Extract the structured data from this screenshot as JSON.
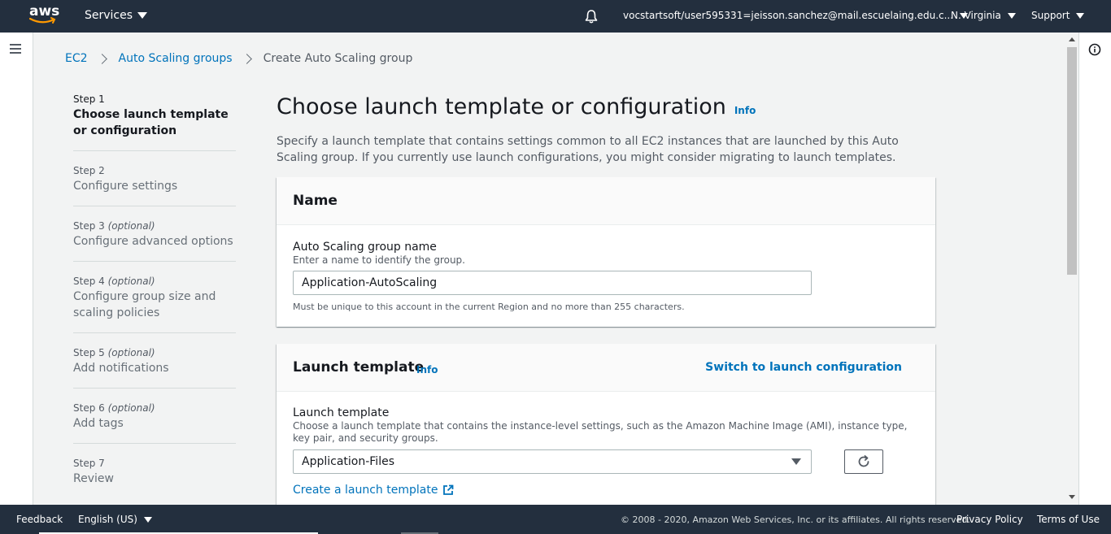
{
  "topnav": {
    "logo_text": "aws",
    "services_label": "Services",
    "account_label": "vocstartsoft/user595331=jeisson.sanchez@mail.escuelaing.edu.c...",
    "region_label": "N. Virginia",
    "support_label": "Support"
  },
  "breadcrumb": {
    "items": [
      "EC2",
      "Auto Scaling groups",
      "Create Auto Scaling group"
    ]
  },
  "steps": [
    {
      "num": "Step 1",
      "optional": "",
      "title": "Choose launch template or configuration"
    },
    {
      "num": "Step 2",
      "optional": "",
      "title": "Configure settings"
    },
    {
      "num": "Step 3",
      "optional": "(optional)",
      "title": "Configure advanced options"
    },
    {
      "num": "Step 4",
      "optional": "(optional)",
      "title": "Configure group size and scaling policies"
    },
    {
      "num": "Step 5",
      "optional": "(optional)",
      "title": "Add notifications"
    },
    {
      "num": "Step 6",
      "optional": "(optional)",
      "title": "Add tags"
    },
    {
      "num": "Step 7",
      "optional": "",
      "title": "Review"
    }
  ],
  "main": {
    "title": "Choose launch template or configuration",
    "info_label": "Info",
    "description": "Specify a launch template that contains settings common to all EC2 instances that are launched by this Auto Scaling group. If you currently use launch configurations, you might consider migrating to launch templates."
  },
  "name_panel": {
    "heading": "Name",
    "field_label": "Auto Scaling group name",
    "field_desc": "Enter a name to identify the group.",
    "field_value": "Application-AutoScaling",
    "constraint": "Must be unique to this account in the current Region and no more than 255 characters."
  },
  "launch_panel": {
    "heading": "Launch template",
    "info_label": "Info",
    "switch_label": "Switch to launch configuration",
    "field_label": "Launch template",
    "field_desc": "Choose a launch template that contains the instance-level settings, such as the Amazon Machine Image (AMI), instance type, key pair, and security groups.",
    "selected_value": "Application-Files",
    "create_label": "Create a launch template"
  },
  "footer": {
    "feedback_label": "Feedback",
    "language_label": "English (US)",
    "copyright": "© 2008 - 2020, Amazon Web Services, Inc. or its affiliates. All rights reserved.",
    "privacy_label": "Privacy Policy",
    "terms_label": "Terms of Use"
  },
  "colors": {
    "nav_bg": "#232f3e",
    "link": "#0073bb",
    "page_bg": "#f2f3f3",
    "smile": "#ff9900"
  }
}
